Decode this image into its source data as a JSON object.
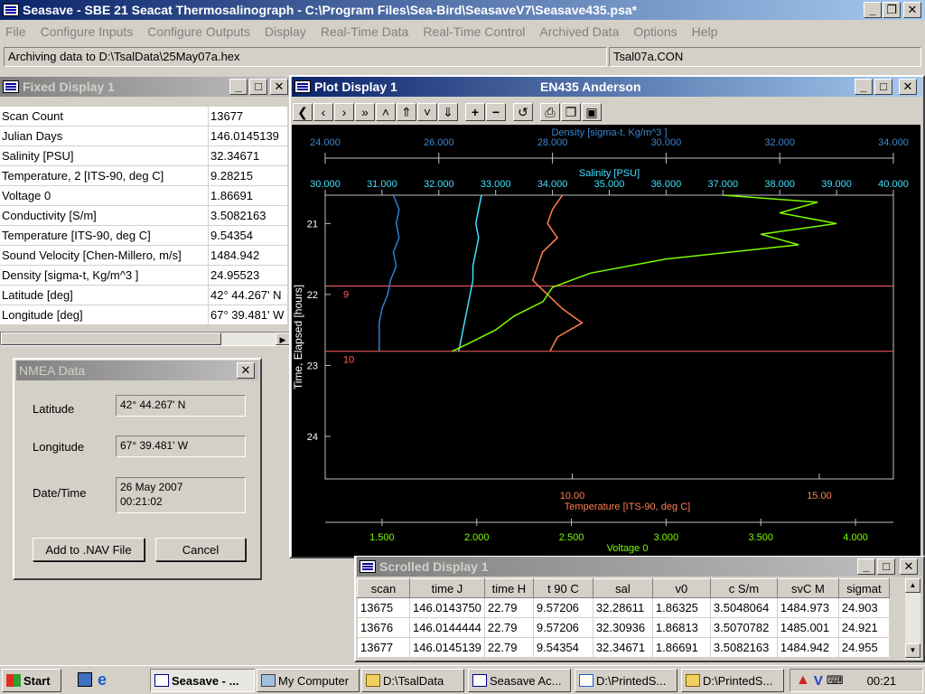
{
  "app": {
    "title": "Seasave - SBE 21 Seacat Thermosalinograph - C:\\Program Files\\Sea-Bird\\SeasaveV7\\Seasave435.psa*",
    "menu": [
      "File",
      "Configure Inputs",
      "Configure Outputs",
      "Display",
      "Real-Time Data",
      "Real-Time Control",
      "Archived Data",
      "Options",
      "Help"
    ],
    "status_archive": "Archiving data to D:\\TsalData\\25May07a.hex",
    "status_con": "Tsal07a.CON"
  },
  "fixed_display": {
    "title": "Fixed Display 1",
    "rows": [
      {
        "label": "Scan Count",
        "value": "13677"
      },
      {
        "label": "Julian Days",
        "value": "146.0145139"
      },
      {
        "label": "Salinity [PSU]",
        "value": "32.34671"
      },
      {
        "label": "Temperature, 2 [ITS-90, deg C]",
        "value": "9.28215"
      },
      {
        "label": "Voltage 0",
        "value": "1.86691"
      },
      {
        "label": "Conductivity [S/m]",
        "value": "3.5082163"
      },
      {
        "label": "Temperature [ITS-90, deg C]",
        "value": "9.54354"
      },
      {
        "label": "Sound Velocity [Chen-Millero, m/s]",
        "value": "1484.942"
      },
      {
        "label": "Density [sigma-t, Kg/m^3 ]",
        "value": "24.95523"
      },
      {
        "label": "Latitude [deg]",
        "value": " 42° 44.267' N"
      },
      {
        "label": "Longitude [deg]",
        "value": " 67° 39.481' W"
      }
    ]
  },
  "nmea": {
    "title": "NMEA Data",
    "lat_label": "Latitude",
    "lat_value": "42° 44.267' N",
    "lon_label": "Longitude",
    "lon_value": "67° 39.481' W",
    "dt_label": "Date/Time",
    "date_value": "26 May 2007",
    "time_value": "00:21:02",
    "add_button": "Add to .NAV File",
    "cancel_button": "Cancel"
  },
  "plot": {
    "title": "Plot Display 1",
    "subtitle": "EN435 Anderson",
    "toolbar": [
      "<",
      "‹",
      "›",
      "»",
      "^",
      "⇑",
      "v",
      "⇓",
      "+",
      "−",
      "↺",
      "print",
      "copy",
      "save"
    ],
    "markers": [
      "9",
      "10"
    ]
  },
  "chart_data": {
    "type": "line",
    "y_axis": {
      "label": "Time, Elapsed [hours]",
      "range": [
        20.6,
        24.6
      ],
      "ticks": [
        "21",
        "22",
        "23",
        "24"
      ],
      "inverted": true
    },
    "top_axes": [
      {
        "label": "Density [sigma-t, Kg/m^3 ]",
        "range": [
          24.0,
          34.0
        ],
        "ticks": [
          "24.000",
          "26.000",
          "28.000",
          "30.000",
          "32.000",
          "34.000"
        ],
        "color": "#3a86d0"
      },
      {
        "label": "Salinity [PSU]",
        "range": [
          30.0,
          40.0
        ],
        "ticks": [
          "30.000",
          "31.000",
          "32.000",
          "33.000",
          "34.000",
          "35.000",
          "36.000",
          "37.000",
          "38.000",
          "39.000",
          "40.000"
        ],
        "color": "#40e0ff"
      }
    ],
    "bottom_axes": [
      {
        "label": "Temperature [ITS-90, deg C]",
        "range": [
          5.0,
          16.5
        ],
        "ticks": [
          "10.00",
          "15.00"
        ],
        "tick_values": [
          10,
          15
        ],
        "color": "#ff7f50"
      },
      {
        "label": "Voltage 0",
        "range": [
          1.2,
          4.2
        ],
        "ticks": [
          "1.500",
          "2.000",
          "2.500",
          "3.000",
          "3.500",
          "4.000"
        ],
        "color": "#7cfc00"
      }
    ],
    "horizontal_markers": [
      {
        "label": "9",
        "y": 21.88
      },
      {
        "label": "10",
        "y": 22.8
      }
    ],
    "series": [
      {
        "name": "Density [sigma-t, Kg/m^3 ]",
        "color": "#2f7fd0",
        "points": [
          [
            25.2,
            20.6
          ],
          [
            25.3,
            20.8
          ],
          [
            25.25,
            21.0
          ],
          [
            25.3,
            21.2
          ],
          [
            25.2,
            21.4
          ],
          [
            25.25,
            21.6
          ],
          [
            25.15,
            21.8
          ],
          [
            25.1,
            22.0
          ],
          [
            25.0,
            22.2
          ],
          [
            24.95,
            22.4
          ],
          [
            24.95,
            22.6
          ],
          [
            24.95,
            22.8
          ]
        ]
      },
      {
        "name": "Salinity [PSU]",
        "color": "#40e0ff",
        "points": [
          [
            32.75,
            20.6
          ],
          [
            32.7,
            20.8
          ],
          [
            32.65,
            21.0
          ],
          [
            32.7,
            21.2
          ],
          [
            32.65,
            21.4
          ],
          [
            32.6,
            21.6
          ],
          [
            32.6,
            21.8
          ],
          [
            32.55,
            22.0
          ],
          [
            32.5,
            22.2
          ],
          [
            32.45,
            22.4
          ],
          [
            32.4,
            22.6
          ],
          [
            32.35,
            22.8
          ]
        ]
      },
      {
        "name": "Temperature [ITS-90, deg C]",
        "color": "#ff7f50",
        "points": [
          [
            9.8,
            20.6
          ],
          [
            9.6,
            20.8
          ],
          [
            9.5,
            21.0
          ],
          [
            9.7,
            21.2
          ],
          [
            9.4,
            21.4
          ],
          [
            9.3,
            21.6
          ],
          [
            9.2,
            21.8
          ],
          [
            9.5,
            22.0
          ],
          [
            9.8,
            22.2
          ],
          [
            10.2,
            22.4
          ],
          [
            9.7,
            22.6
          ],
          [
            9.55,
            22.8
          ]
        ]
      },
      {
        "name": "Voltage 0",
        "color": "#7cfc00",
        "points": [
          [
            3.3,
            20.6
          ],
          [
            3.8,
            20.7
          ],
          [
            3.6,
            20.85
          ],
          [
            3.9,
            21.0
          ],
          [
            3.5,
            21.15
          ],
          [
            3.7,
            21.3
          ],
          [
            3.0,
            21.5
          ],
          [
            2.6,
            21.7
          ],
          [
            2.4,
            21.9
          ],
          [
            2.35,
            22.1
          ],
          [
            2.2,
            22.3
          ],
          [
            2.1,
            22.5
          ],
          [
            1.95,
            22.7
          ],
          [
            1.87,
            22.8
          ]
        ]
      }
    ]
  },
  "scrolled": {
    "title": "Scrolled Display 1",
    "headers": [
      "scan",
      "time J",
      "time H",
      "t 90 C",
      "sal",
      "v0",
      "c S/m",
      "svC M",
      "sigmat"
    ],
    "rows": [
      [
        "13675",
        "146.0143750",
        "22.79",
        "9.57206",
        "32.28611",
        "1.86325",
        "3.5048064",
        "1484.973",
        "24.903"
      ],
      [
        "13676",
        "146.0144444",
        "22.79",
        "9.57206",
        "32.30936",
        "1.86813",
        "3.5070782",
        "1485.001",
        "24.921"
      ],
      [
        "13677",
        "146.0145139",
        "22.79",
        "9.54354",
        "32.34671",
        "1.86691",
        "3.5082163",
        "1484.942",
        "24.955"
      ]
    ]
  },
  "taskbar": {
    "start": "Start",
    "tasks": [
      "Seasave - ...",
      "My Computer",
      "D:\\TsalData",
      "Seasave Ac...",
      "D:\\PrintedS...",
      "D:\\PrintedS..."
    ],
    "clock": "00:21"
  },
  "colors": {
    "title_active": "#0a246a",
    "title_inactive": "#808080",
    "plot_bg": "#000000",
    "marker": "#ff6060"
  }
}
